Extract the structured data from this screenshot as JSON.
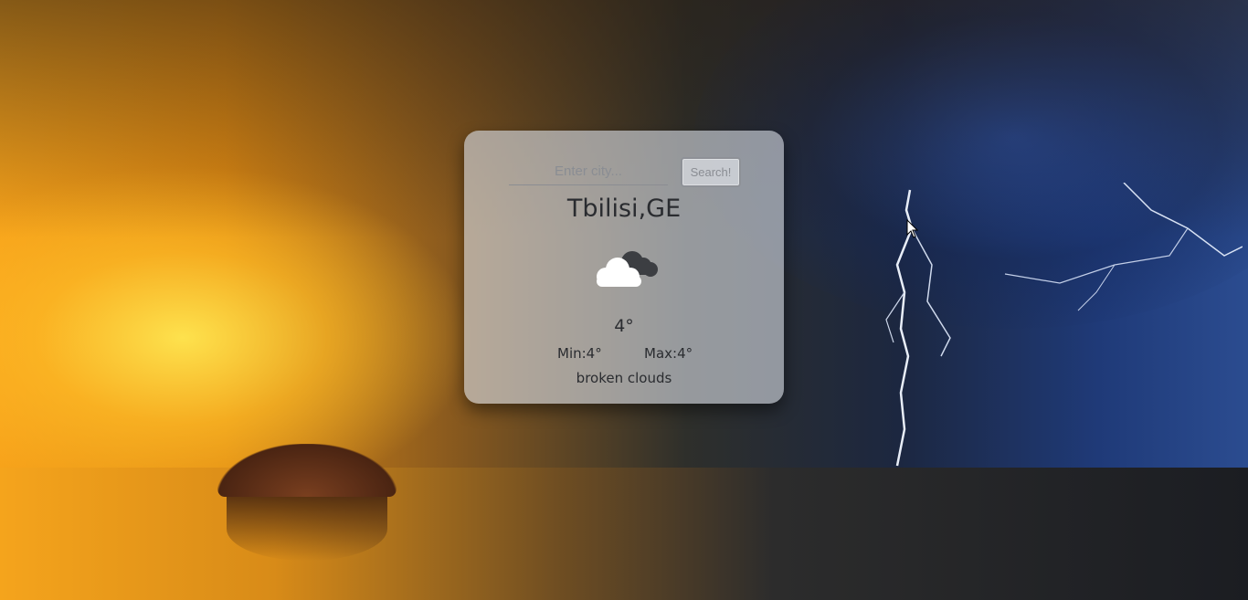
{
  "search": {
    "placeholder": "Enter city...",
    "button_label": "Search!"
  },
  "weather": {
    "city": "Tbilisi,GE",
    "icon": "broken-clouds-icon",
    "temperature": "4°",
    "min": "Min:4°",
    "max": "Max:4°",
    "description": "broken clouds"
  }
}
